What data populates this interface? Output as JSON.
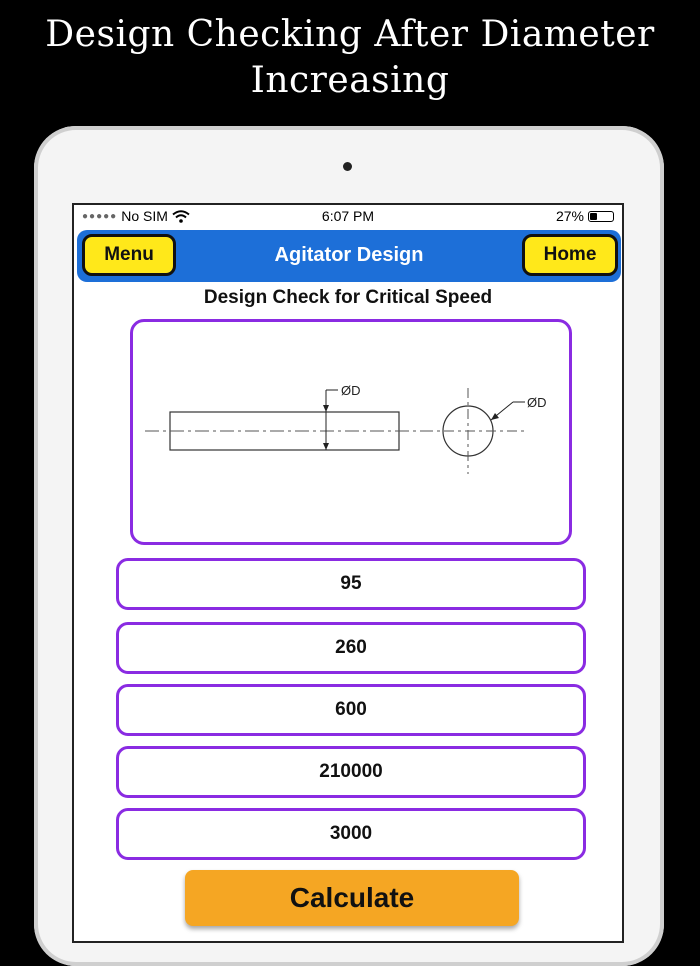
{
  "promo": {
    "line1": "Design Checking After Diameter",
    "line2": "Increasing"
  },
  "status_bar": {
    "carrier": "No SIM",
    "time": "6:07 PM",
    "battery": "27%"
  },
  "nav": {
    "menu_label": "Menu",
    "title": "Agitator Design",
    "home_label": "Home"
  },
  "section_title": "Design Check for Critical Speed",
  "diagram": {
    "label_shaft": "ØD",
    "label_section": "ØD"
  },
  "fields": [
    {
      "value": "95"
    },
    {
      "value": "260"
    },
    {
      "value": "600"
    },
    {
      "value": "210000"
    },
    {
      "value": "3000"
    }
  ],
  "calculate_label": "Calculate",
  "colors": {
    "nav_bg": "#1d6fd8",
    "nav_button": "#ffe81a",
    "field_border": "#8a2be2",
    "calculate_bg": "#f5a623"
  }
}
